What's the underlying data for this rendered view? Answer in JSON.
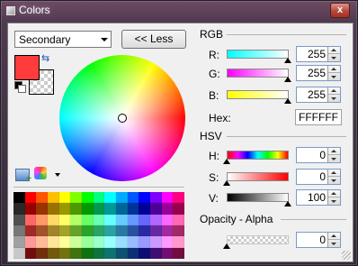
{
  "window": {
    "title": "Colors",
    "close_glyph": "x"
  },
  "left": {
    "mode_select": "Secondary",
    "less_button": "<< Less",
    "primary_color": "#FF3B3B",
    "swap_glyph": "⇆"
  },
  "rgb": {
    "section": "RGB",
    "r_label": "R:",
    "r_value": "255",
    "g_label": "G:",
    "g_value": "255",
    "b_label": "B:",
    "b_value": "255",
    "hex_label": "Hex:",
    "hex_value": "FFFFFF"
  },
  "hsv": {
    "section": "HSV",
    "h_label": "H:",
    "h_value": "0",
    "s_label": "S:",
    "s_value": "0",
    "v_label": "V:",
    "v_value": "100"
  },
  "opacity": {
    "section": "Opacity - Alpha",
    "value": "0"
  },
  "colors": {
    "accent_red": "#FF3B3B"
  }
}
